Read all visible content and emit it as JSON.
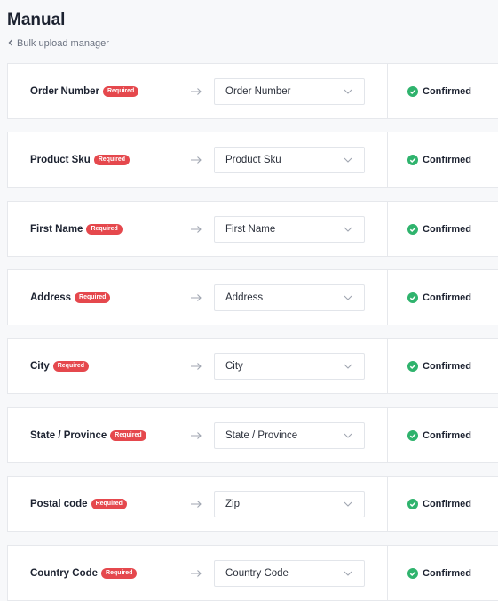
{
  "header": {
    "title": "Manual",
    "back_label": "Bulk upload manager"
  },
  "colors": {
    "required_badge": "#e5484d",
    "confirmed_check": "#2fb36d",
    "background": "#f7f8fa"
  },
  "icons": {
    "back": "chevron-left-icon",
    "arrow": "arrow-right-icon",
    "select": "chevron-down-icon",
    "status": "check-circle-icon"
  },
  "mappings": [
    {
      "field": "Order Number",
      "badge": "Required",
      "selected": "Order Number",
      "status": "Confirmed"
    },
    {
      "field": "Product Sku",
      "badge": "Required",
      "selected": "Product Sku",
      "status": "Confirmed"
    },
    {
      "field": "First Name",
      "badge": "Required",
      "selected": "First Name",
      "status": "Confirmed"
    },
    {
      "field": "Address",
      "badge": "Required",
      "selected": "Address",
      "status": "Confirmed"
    },
    {
      "field": "City",
      "badge": "Required",
      "selected": "City",
      "status": "Confirmed"
    },
    {
      "field": "State / Province",
      "badge": "Required",
      "selected": "State / Province",
      "status": "Confirmed"
    },
    {
      "field": "Postal code",
      "badge": "Required",
      "selected": "Zip",
      "status": "Confirmed"
    },
    {
      "field": "Country Code",
      "badge": "Required",
      "selected": "Country Code",
      "status": "Confirmed"
    }
  ]
}
